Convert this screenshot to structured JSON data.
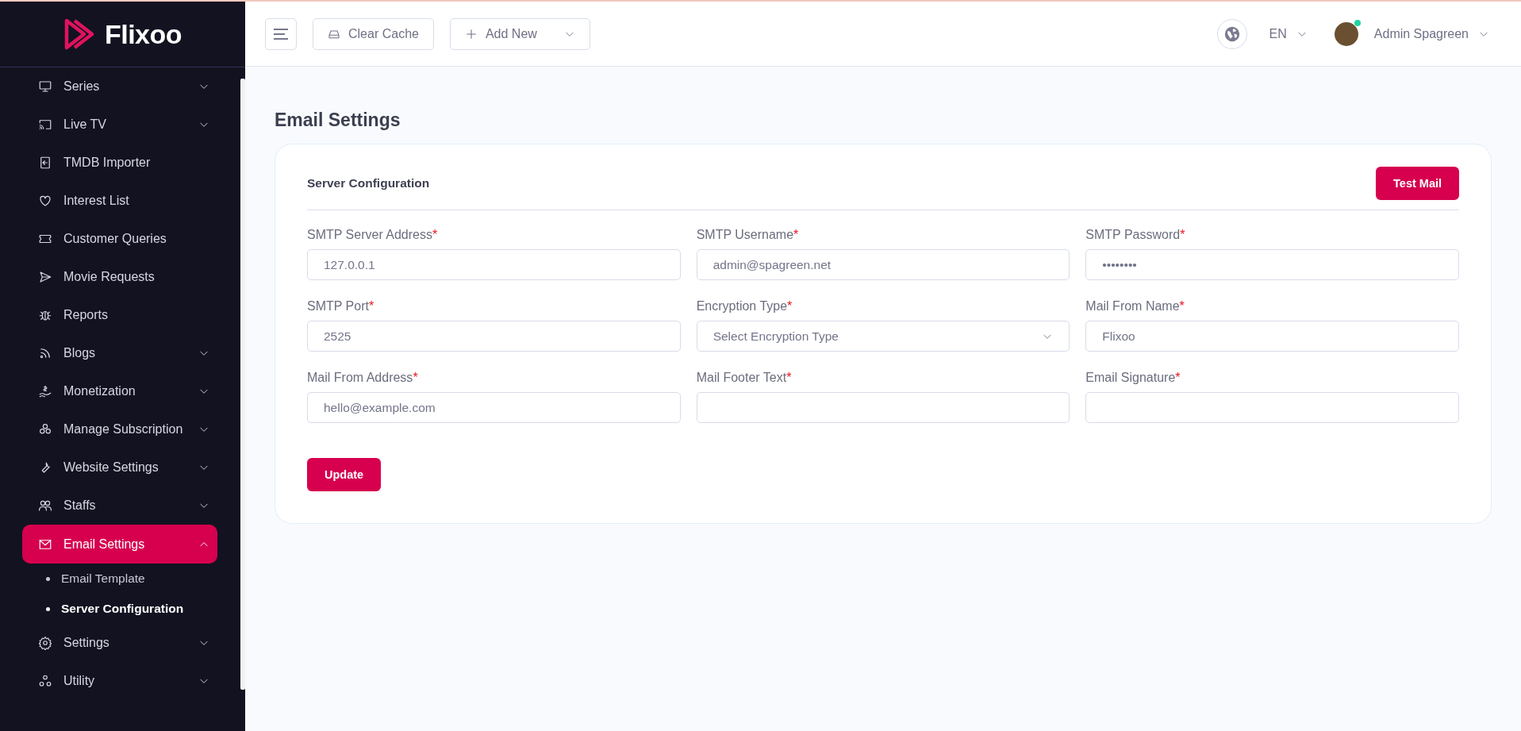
{
  "app": {
    "name": "Flixoo"
  },
  "sidebar": {
    "items": [
      {
        "label": "Series",
        "kind": "dropdown",
        "expanded": false,
        "selected": false
      },
      {
        "label": "Live TV",
        "kind": "dropdown",
        "expanded": false,
        "selected": false
      },
      {
        "label": "TMDB Importer",
        "kind": "link",
        "selected": false
      },
      {
        "label": "Interest List",
        "kind": "link",
        "selected": false
      },
      {
        "label": "Customer Queries",
        "kind": "link",
        "selected": false
      },
      {
        "label": "Movie Requests",
        "kind": "link",
        "selected": false
      },
      {
        "label": "Reports",
        "kind": "link",
        "selected": false
      },
      {
        "label": "Blogs",
        "kind": "dropdown",
        "expanded": false,
        "selected": false
      },
      {
        "label": "Monetization",
        "kind": "dropdown",
        "expanded": false,
        "selected": false
      },
      {
        "label": "Manage Subscription",
        "kind": "dropdown",
        "expanded": false,
        "selected": false
      },
      {
        "label": "Website Settings",
        "kind": "dropdown",
        "expanded": false,
        "selected": false
      },
      {
        "label": "Staffs",
        "kind": "dropdown",
        "expanded": false,
        "selected": false
      },
      {
        "label": "Email Settings",
        "kind": "dropdown",
        "expanded": true,
        "selected": true,
        "children": [
          {
            "label": "Email Template",
            "selected": false
          },
          {
            "label": "Server Configuration",
            "selected": true
          }
        ]
      },
      {
        "label": "Settings",
        "kind": "dropdown",
        "expanded": false,
        "selected": false
      },
      {
        "label": "Utility",
        "kind": "dropdown",
        "expanded": false,
        "selected": false
      }
    ]
  },
  "topbar": {
    "buttons": [
      {
        "label": "Clear Cache",
        "kind": "cache"
      },
      {
        "label": "Add New",
        "kind": "add"
      }
    ],
    "language": "EN",
    "user": {
      "name": "Admin Spagreen",
      "online": true
    }
  },
  "page": {
    "title": "Email Settings"
  },
  "card": {
    "title": "Server Configuration",
    "action": "Test Mail",
    "fields": [
      {
        "label": "SMTP Server Address",
        "mark": "*",
        "kind": "text",
        "value": "127.0.0.1"
      },
      {
        "label": "SMTP Username",
        "mark": "*",
        "kind": "text",
        "value": "admin@spagreen.net"
      },
      {
        "label": "SMTP Password",
        "mark": "*",
        "kind": "text",
        "value": "••••••••"
      },
      {
        "label": "SMTP Port",
        "mark": "*",
        "kind": "text",
        "value": "2525"
      },
      {
        "label": "Encryption Type",
        "mark": "*",
        "kind": "select",
        "value": "Select Encryption Type"
      },
      {
        "label": "Mail From Name",
        "mark": "*",
        "kind": "text",
        "value": "Flixoo"
      },
      {
        "label": "Mail From Address",
        "mark": "*",
        "kind": "text",
        "value": "hello@example.com"
      },
      {
        "label": "Mail Footer Text",
        "mark": "*",
        "kind": "text"
      },
      {
        "label": "Email Signature",
        "mark": "*",
        "kind": "text"
      }
    ],
    "submit": "Update"
  }
}
